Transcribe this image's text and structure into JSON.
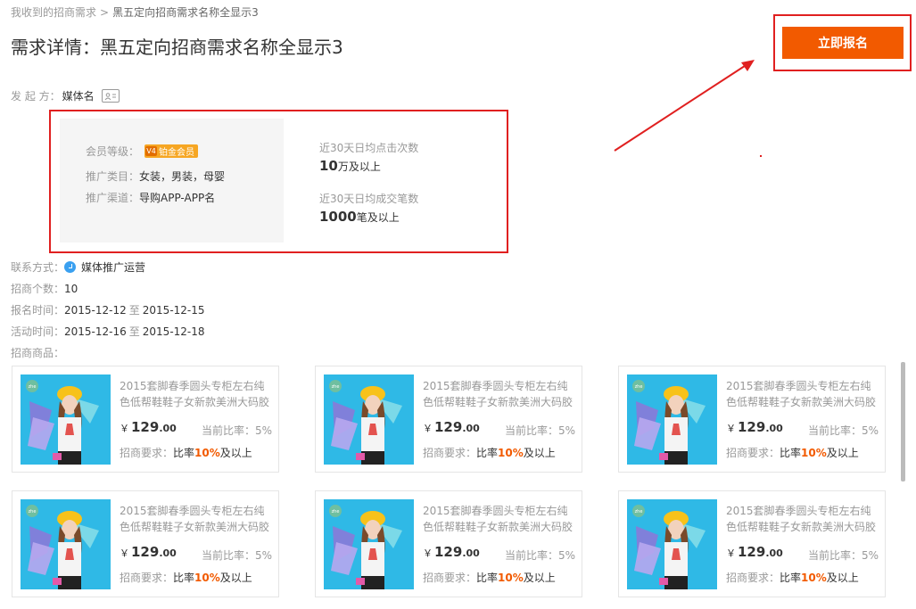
{
  "breadcrumb": {
    "parent": "我收到的招商需求",
    "separator": ">",
    "current": "黑五定向招商需求名称全显示3"
  },
  "header": {
    "title": "需求详情：黑五定向招商需求名称全显示3",
    "signup_label": "立即报名"
  },
  "initiator": {
    "label": "发 起 方：",
    "value": "媒体名"
  },
  "info": {
    "member_level_label": "会员等级：",
    "member_level_badge": "铂金会员",
    "member_level_badge_icon": "V4",
    "category_label": "推广类目：",
    "category_value": "女装，男装，母婴",
    "channel_label": "推广渠道：",
    "channel_value": "导购APP-APP名",
    "clicks_label": "近30天日均点击次数",
    "clicks_num": "10",
    "clicks_unit": "万及以上",
    "orders_label": "近30天日均成交笔数",
    "orders_num": "1000",
    "orders_unit": "笔及以上"
  },
  "meta": {
    "contact_label": "联系方式：",
    "contact_value": "媒体推广运营",
    "count_label": "招商个数：",
    "count_value": "10",
    "signup_time_label": "报名时间：",
    "signup_start": "2015-12-12",
    "to": "至",
    "signup_end": "2015-12-15",
    "activity_time_label": "活动时间：",
    "activity_start": "2015-12-16",
    "activity_end": "2015-12-18",
    "products_label": "招商商品："
  },
  "products": [
    {
      "name": "2015套脚春季圆头专柜左右纯色低帮鞋鞋子女新款美洲大码胶",
      "currency": "￥",
      "price_int": "129",
      "price_dec": ".00",
      "ratio": "当前比率：5%",
      "req_label": "招商要求：",
      "req_prefix": "比率",
      "req_value": "10%",
      "req_suffix": "及以上"
    },
    {
      "name": "2015套脚春季圆头专柜左右纯色低帮鞋鞋子女新款美洲大码胶",
      "currency": "￥",
      "price_int": "129",
      "price_dec": ".00",
      "ratio": "当前比率：5%",
      "req_label": "招商要求：",
      "req_prefix": "比率",
      "req_value": "10%",
      "req_suffix": "及以上"
    },
    {
      "name": "2015套脚春季圆头专柜左右纯色低帮鞋鞋子女新款美洲大码胶",
      "currency": "￥",
      "price_int": "129",
      "price_dec": ".00",
      "ratio": "当前比率：5%",
      "req_label": "招商要求：",
      "req_prefix": "比率",
      "req_value": "10%",
      "req_suffix": "及以上"
    },
    {
      "name": "2015套脚春季圆头专柜左右纯色低帮鞋鞋子女新款美洲大码胶",
      "currency": "￥",
      "price_int": "129",
      "price_dec": ".00",
      "ratio": "当前比率：5%",
      "req_label": "招商要求：",
      "req_prefix": "比率",
      "req_value": "10%",
      "req_suffix": "及以上"
    },
    {
      "name": "2015套脚春季圆头专柜左右纯色低帮鞋鞋子女新款美洲大码胶",
      "currency": "￥",
      "price_int": "129",
      "price_dec": ".00",
      "ratio": "当前比率：5%",
      "req_label": "招商要求：",
      "req_prefix": "比率",
      "req_value": "10%",
      "req_suffix": "及以上"
    },
    {
      "name": "2015套脚春季圆头专柜左右纯色低帮鞋鞋子女新款美洲大码胶",
      "currency": "￥",
      "price_int": "129",
      "price_dec": ".00",
      "ratio": "当前比率：5%",
      "req_label": "招商要求：",
      "req_prefix": "比率",
      "req_value": "10%",
      "req_suffix": "及以上"
    }
  ],
  "colors": {
    "accent": "#f25a00",
    "annotation": "#e02020",
    "badge": "#f6a623",
    "thumb_bg": "#2fb9e6"
  },
  "icons": {
    "contact": "contact-status-icon",
    "card": "id-card-icon",
    "vip": "vip-level-icon"
  }
}
